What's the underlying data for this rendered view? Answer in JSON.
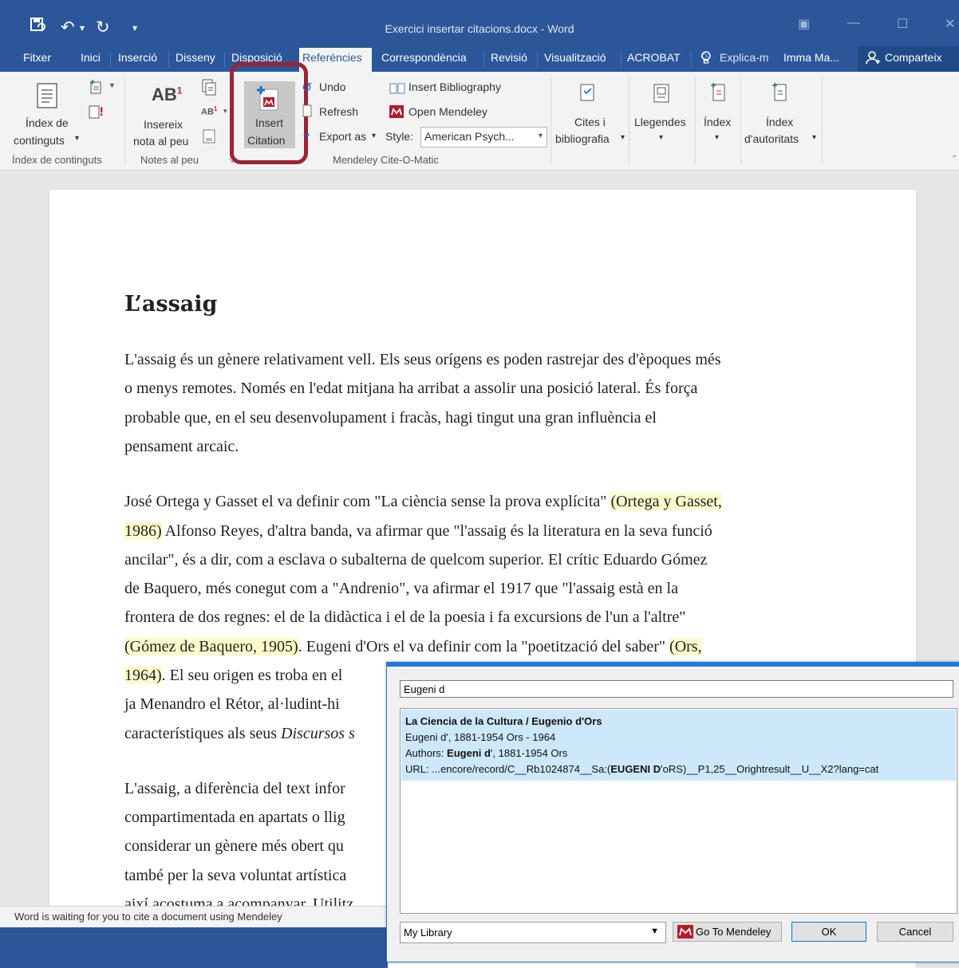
{
  "window": {
    "title": "Exercici insertar citacions.docx - Word",
    "quick_access": [
      "save-icon",
      "undo-icon",
      "redo-icon",
      "customize-icon"
    ]
  },
  "tabs": [
    "Fitxer",
    "Inici",
    "Inserció",
    "Disseny",
    "Disposició",
    "Referències",
    "Correspondència",
    "Revisió",
    "Visualització",
    "ACROBAT"
  ],
  "active_tab": "Referències",
  "tell_me": "Explica-m",
  "user": "Imma Ma...",
  "share": "Comparteix",
  "ribbon": {
    "toc": {
      "label1": "Índex de",
      "label2": "continguts",
      "group": "Índex de continguts"
    },
    "footnotes": {
      "label1": "Insereix",
      "label2": "nota al peu",
      "ab_text": "AB",
      "ab_sup": "1",
      "group": "Notes al peu"
    },
    "mendeley": {
      "insert_citation1": "Insert",
      "insert_citation2": "Citation",
      "undo": "Undo",
      "refresh": "Refresh",
      "export_as": "Export as",
      "style_label": "Style:",
      "style_value": "American Psych...",
      "insert_bibliography": "Insert Bibliography",
      "open_mendeley": "Open Mendeley",
      "group": "Mendeley Cite-O-Matic"
    },
    "citations": {
      "label1": "Cites i",
      "label2": "bibliografia"
    },
    "captions": {
      "label": "Llegendes"
    },
    "index": {
      "label": "Índex"
    },
    "authorities": {
      "label1": "Índex",
      "label2": "d'autoritats"
    }
  },
  "document": {
    "heading": "L’assaig",
    "p1": [
      "L'assaig és un gènere relativament vell. Els seus orígens es poden rastrejar des d'èpoques més",
      "o menys remotes. Només en l'edat mitjana ha arribat a assolir una posició lateral. És força",
      "probable que, en el seu desenvolupament i fracàs, hagi tingut una gran influència el",
      "pensament arcaic."
    ],
    "p2": {
      "l1a": "José Ortega y Gasset el va definir com \"La ciència sense la prova explícita\" ",
      "l1b": "(Ortega y Gasset,",
      "l2a": "1986)",
      "l2b": " Alfonso Reyes, d'altra banda, va afirmar que \"l'assaig és la literatura en la seva funció",
      "l3": "ancilar\", és a dir, com a esclava o subalterna de quelcom superior. El crític Eduardo Gómez",
      "l4": "de Baquero, més conegut com a \"Andrenio\", va afirmar el 1917 que \"l'assaig està en la",
      "l5": "frontera de dos regnes: el de la didàctica i el de la poesia i fa excursions de l'un a l'altre\"",
      "l6a": "(Gómez de Baquero, 1905)",
      "l6b": ". Eugeni d'Ors el va definir com la \"poetització del saber\" ",
      "l6c": "(Ors,",
      "l7a": "1964)",
      "l7b": ". El seu origen es troba en el",
      "l8": "ja Menandro el Rétor, al·ludint-hi",
      "l9a": "característiques als seus ",
      "l9b": "Discursos s"
    },
    "p3": [
      "L'assaig, a diferència del text infor",
      "compartimentada en apartats o llig",
      "considerar un gènere més obert qu",
      "també per la seva voluntat artística",
      "així acostuma a acompanyar. Utilitz"
    ]
  },
  "status_text": "Word is waiting for you to cite a document using Mendeley",
  "dialog": {
    "search_value": "Eugeni d",
    "result": {
      "title": "La Ciencia de la Cultura / Eugenio d'Ors",
      "line2": "Eugeni d', 1881-1954 Ors - 1964",
      "authors_label": "Authors: ",
      "authors_bold": "Eugeni d",
      "authors_rest": "', 1881-1954 Ors",
      "url_prefix": "URL: ...encore/record/C__Rb1024874__Sa:(",
      "url_bold": "EUGENI D",
      "url_rest": "'oRS)__P1,25__Orightresult__U__X2?lang=cat"
    },
    "library": "My Library",
    "go_to_mendeley": "Go To Mendeley",
    "ok": "OK",
    "cancel": "Cancel"
  },
  "colors": {
    "word_blue": "#2b579a",
    "highlight": "#fdfacb",
    "callout": "#9b2335",
    "selection": "#cde8fa"
  }
}
